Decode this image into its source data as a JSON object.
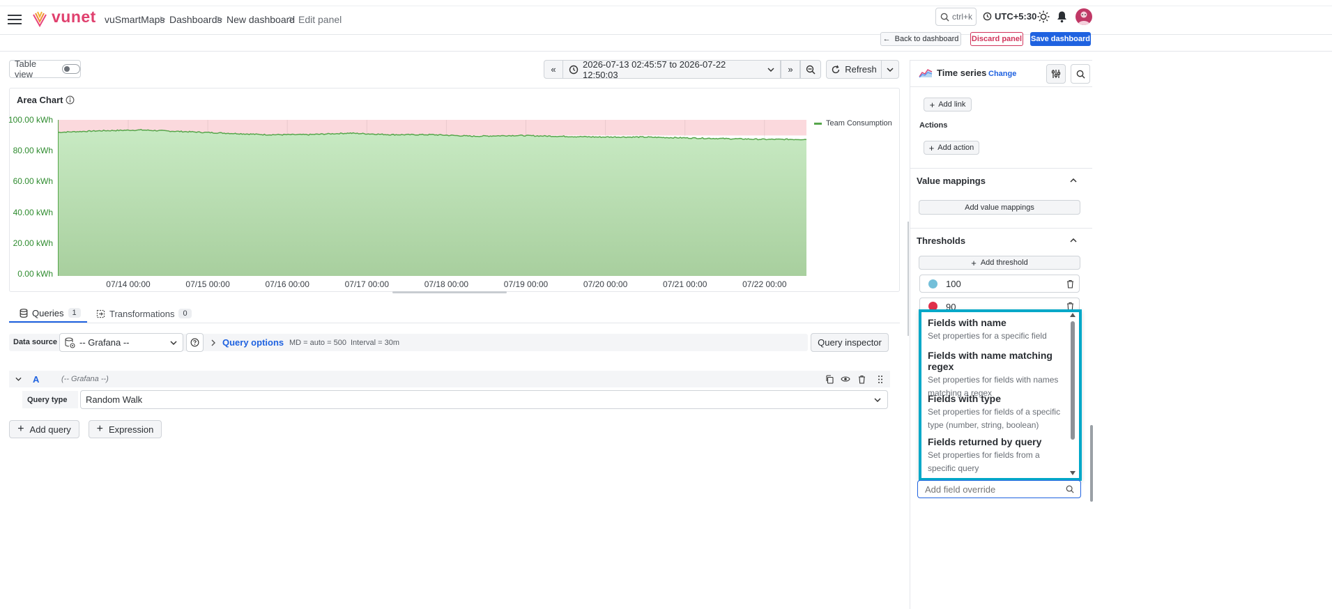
{
  "brand": {
    "name": "vunet"
  },
  "breadcrumb": [
    "vuSmartMaps",
    "Dashboards",
    "New dashboard",
    "Edit panel"
  ],
  "topbar": {
    "search_hint": "ctrl+k",
    "timezone": "UTC+5:30"
  },
  "actions": {
    "back": "Back to dashboard",
    "discard": "Discard panel",
    "save": "Save dashboard"
  },
  "toolbar": {
    "table_view": "Table view",
    "time_range": "2026-07-13 02:45:57 to 2026-07-22 12:50:03",
    "refresh": "Refresh"
  },
  "panel": {
    "title": "Area Chart",
    "legend": "Team Consumption"
  },
  "chart_data": {
    "type": "area",
    "title": "Area Chart",
    "series": [
      {
        "name": "Team Consumption",
        "color": "#56a64b",
        "x": [
          "07/13 14:00",
          "07/14 00:00",
          "07/14 12:00",
          "07/15 00:00",
          "07/15 12:00",
          "07/16 00:00",
          "07/16 12:00",
          "07/17 00:00",
          "07/17 12:00",
          "07/18 00:00",
          "07/18 12:00",
          "07/19 00:00",
          "07/19 12:00",
          "07/20 00:00",
          "07/20 12:00",
          "07/21 00:00",
          "07/21 12:00",
          "07/22 00:00",
          "07/22 12:00"
        ],
        "values": [
          92,
          93,
          93.5,
          92.5,
          91.5,
          90.5,
          90.5,
          91.5,
          90.5,
          90.5,
          89.5,
          90,
          89.5,
          89,
          89,
          88.5,
          88,
          87.5,
          87.5
        ]
      }
    ],
    "y_ticks": [
      "100.00 kWh",
      "80.00 kWh",
      "60.00 kWh",
      "40.00 kWh",
      "20.00 kWh",
      "0.00 kWh"
    ],
    "x_ticks": [
      "07/14 00:00",
      "07/15 00:00",
      "07/16 00:00",
      "07/17 00:00",
      "07/18 00:00",
      "07/19 00:00",
      "07/20 00:00",
      "07/21 00:00",
      "07/22 00:00"
    ],
    "ylim": [
      0,
      100
    ],
    "thresholds": [
      {
        "value": 90,
        "color": "#f2495c"
      }
    ],
    "grid": true,
    "legend_position": "top-right"
  },
  "tabs": [
    {
      "label": "Queries",
      "count": "1"
    },
    {
      "label": "Transformations",
      "count": "0"
    }
  ],
  "query_bar": {
    "datasource_label": "Data source",
    "datasource_value": "-- Grafana --",
    "query_options": "Query options",
    "md": "MD = auto = 500",
    "interval": "Interval = 30m",
    "inspector": "Query inspector"
  },
  "query": {
    "ref": "A",
    "source": "(-- Grafana --)",
    "type_label": "Query type",
    "type_value": "Random Walk"
  },
  "query_buttons": {
    "add_query": "Add query",
    "expression": "Expression"
  },
  "right_panel": {
    "viz_name": "Time series",
    "change": "Change",
    "add_link": "Add link",
    "actions_label": "Actions",
    "add_action": "Add action",
    "value_mappings": "Value mappings",
    "add_value_mappings": "Add value mappings",
    "thresholds": "Thresholds",
    "add_threshold": "Add threshold",
    "threshold_items": [
      {
        "value": "100",
        "color": "#73bfd9"
      },
      {
        "value": "90",
        "color": "#e0304a"
      }
    ],
    "override_options": [
      {
        "title": "Fields with name",
        "desc": "Set properties for a specific field"
      },
      {
        "title": "Fields with name matching regex",
        "desc": "Set properties for fields with names matching a regex"
      },
      {
        "title": "Fields with type",
        "desc": "Set properties for fields of a specific type (number, string, boolean)"
      },
      {
        "title": "Fields returned by query",
        "desc": "Set properties for fields from a specific query"
      }
    ],
    "override_placeholder": "Add field override"
  },
  "colors": {
    "accent": "#1f62e0",
    "highlight": "#00a8c8",
    "danger": "#d1345b"
  }
}
